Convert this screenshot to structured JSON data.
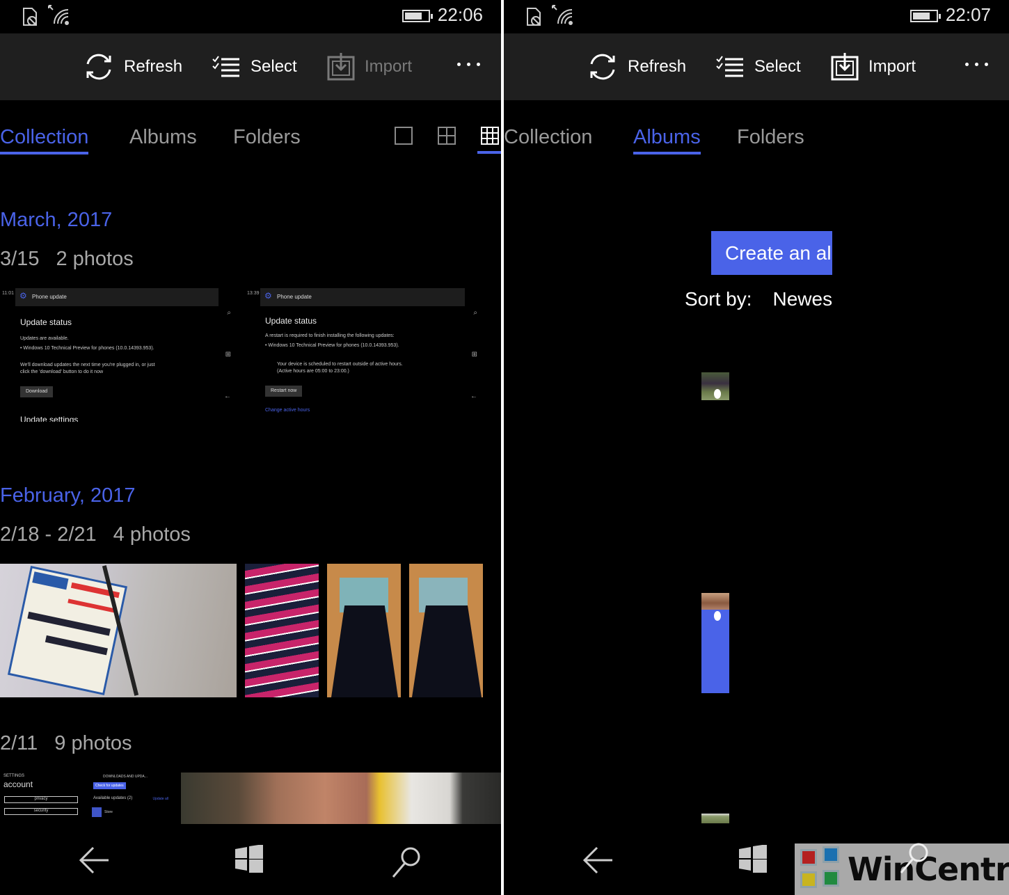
{
  "left": {
    "status": {
      "time": "22:06"
    },
    "appbar": {
      "refresh": "Refresh",
      "select": "Select",
      "import": "Import",
      "import_disabled": true
    },
    "pivot": {
      "tabs": [
        "Collection",
        "Albums",
        "Folders"
      ],
      "active": "Collection",
      "view_modes": [
        "large",
        "medium",
        "small"
      ],
      "active_view": "small"
    },
    "groups": [
      {
        "month": "March, 2017",
        "days": [
          {
            "range": "3/15",
            "count": "2 photos",
            "thumbs": [
              {
                "type": "screenshot",
                "clock": "11:01",
                "header": "Phone update",
                "title": "Update status",
                "lines": [
                  "Updates are available.",
                  "• Windows 10 Technical Preview for phones (10.0.14393.953).",
                  "We'll download updates the next time you're plugged in, or just",
                  "click the 'download' button to do it now"
                ],
                "button": "Download",
                "footer": "Update settings"
              },
              {
                "type": "screenshot",
                "clock": "13:39",
                "header": "Phone update",
                "title": "Update status",
                "lines": [
                  "A restart is required to finish installing the following updates:",
                  "• Windows 10 Technical Preview for phones (10.0.14393.953).",
                  "Your device is scheduled to restart outside of active hours.",
                  "(Active hours are 05:00 to 23:00.)"
                ],
                "button": "Restart now",
                "link": "Change active hours"
              }
            ]
          }
        ]
      },
      {
        "month": "February, 2017",
        "days": [
          {
            "range": "2/18 - 2/21",
            "count": "4 photos",
            "thumbs": [
              {
                "type": "photo",
                "subject": "Kent Rain Drops Services sign"
              },
              {
                "type": "photo",
                "subject": "striped dress"
              },
              {
                "type": "photo",
                "subject": "patterned dress"
              },
              {
                "type": "photo",
                "subject": "patterned dress"
              }
            ]
          },
          {
            "range": "2/11",
            "count": "9 photos",
            "thumbs": [
              {
                "type": "screenshot",
                "header": "SETTINGS",
                "title": "account",
                "buttons": [
                  "privacy",
                  "security"
                ]
              },
              {
                "type": "screenshot",
                "header": "DOWNLOADS AND UPDA...",
                "button": "Check for updates",
                "lines": [
                  "Available updates (2)"
                ],
                "link": "Update all",
                "item": "Store"
              },
              {
                "type": "photo",
                "subject": "selfie"
              }
            ]
          }
        ]
      }
    ]
  },
  "right": {
    "status": {
      "time": "22:07"
    },
    "appbar": {
      "refresh": "Refresh",
      "select": "Select",
      "import": "Import",
      "import_disabled": false
    },
    "pivot": {
      "tabs": [
        "Collection",
        "Albums",
        "Folders"
      ],
      "active": "Albums"
    },
    "albums": {
      "create_label": "Create an album",
      "sort_label": "Sort by:",
      "sort_value": "Newest"
    }
  },
  "navbar": {
    "back": "back-icon",
    "start": "windows-start-icon",
    "search": "search-icon"
  },
  "watermark": {
    "text": "WinCentral"
  },
  "colors": {
    "accent": "#4a63e8",
    "appbar": "#1f1f1f",
    "background": "#000000"
  }
}
